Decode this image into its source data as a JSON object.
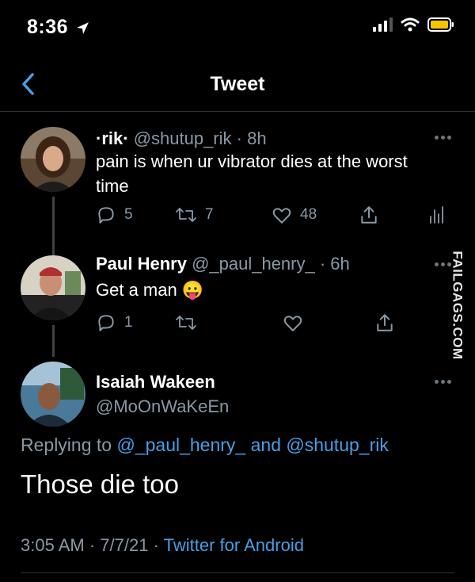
{
  "status_bar": {
    "time": "8:36"
  },
  "nav": {
    "title": "Tweet"
  },
  "thread": [
    {
      "display_name": "·rik·",
      "handle": "@shutup_rik",
      "time": "· 8h",
      "text": "pain is when ur vibrator dies at the worst time",
      "replies": "5",
      "retweets": "7",
      "likes": "48"
    },
    {
      "display_name": "Paul Henry",
      "handle": "@_paul_henry_",
      "time": "· 6h",
      "text": "Get a man",
      "emoji": "😛",
      "replies": "1",
      "retweets": "",
      "likes": ""
    }
  ],
  "main_tweet": {
    "display_name": "Isaiah Wakeen",
    "handle": "@MoOnWaKeEn",
    "replying_prefix": "Replying to",
    "replying_to_1": "@_paul_henry_",
    "replying_and": "and",
    "replying_to_2": "@shutup_rik",
    "text": "Those die too",
    "time": "3:05 AM",
    "date": "7/7/21",
    "source": "Twitter for Android"
  },
  "watermark": "FAILGAGS.COM",
  "colors": {
    "background": "#000000",
    "accent": "#4a9de6",
    "secondary_text": "#8b98a5"
  }
}
